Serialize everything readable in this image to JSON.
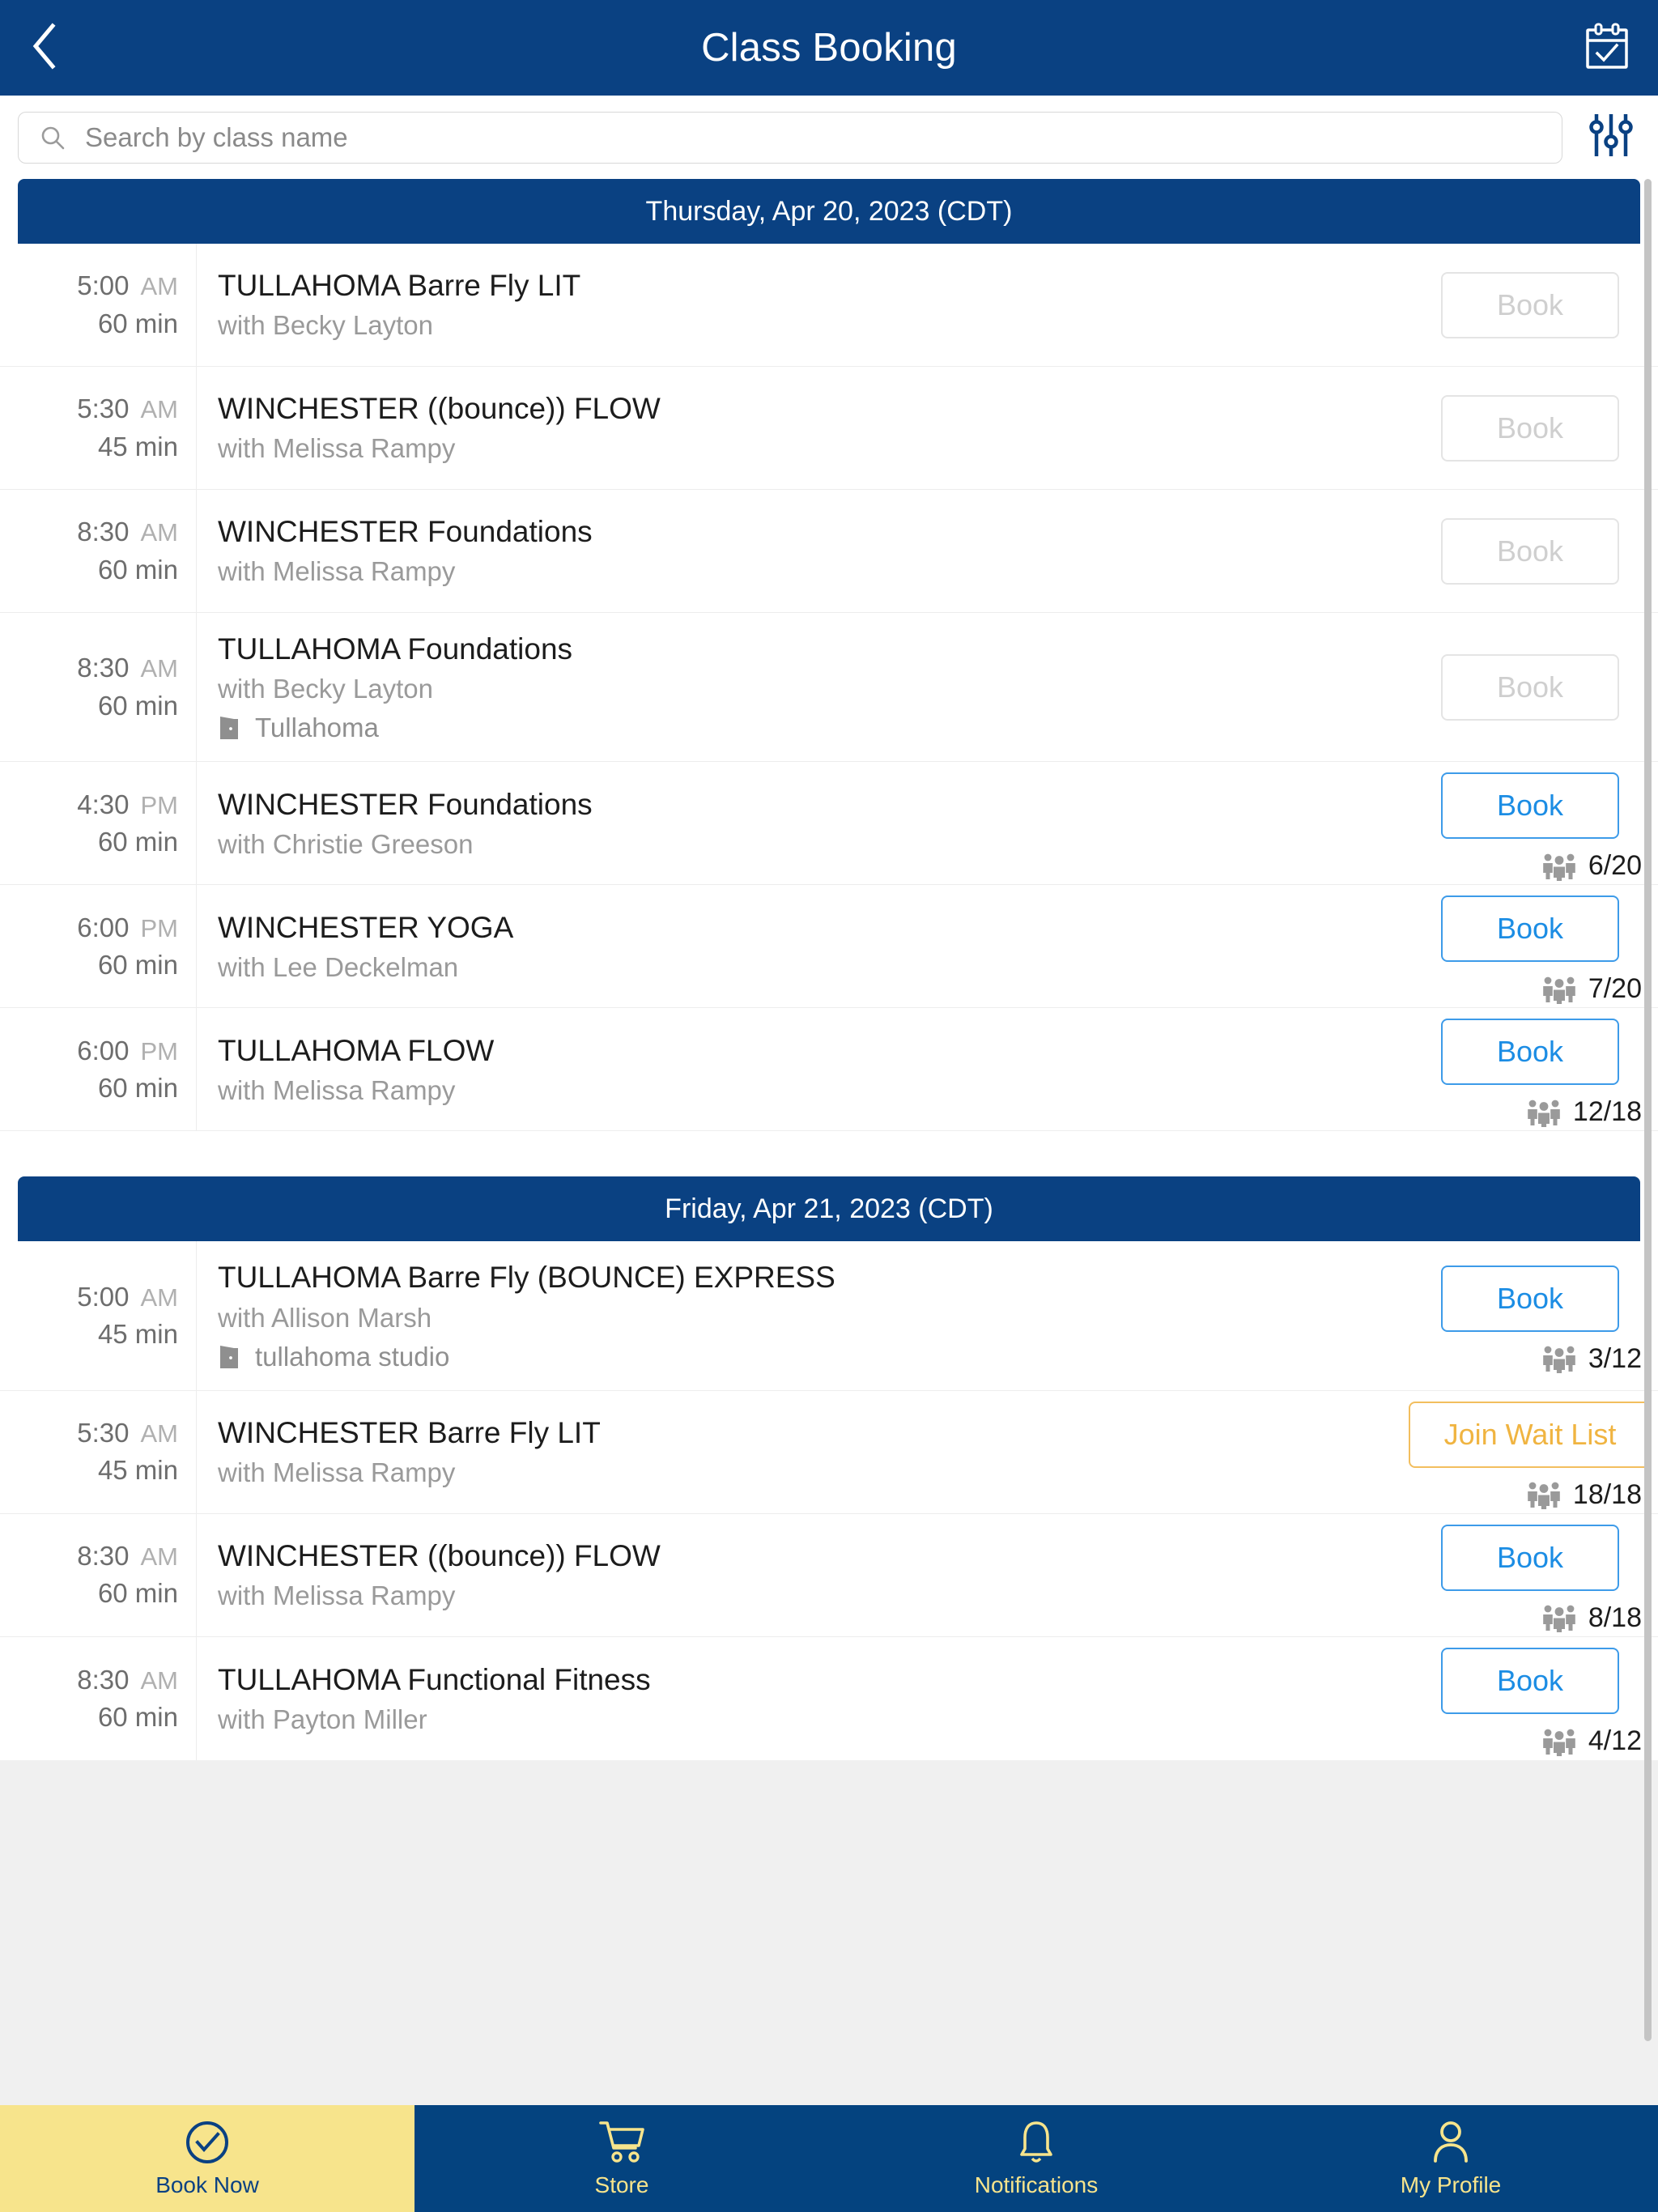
{
  "appbar": {
    "title": "Class Booking",
    "back_icon": "chevron-left-icon",
    "calendar_icon": "calendar-check-icon"
  },
  "search": {
    "placeholder": "Search by class name",
    "value": "",
    "icon": "search-icon",
    "filter_icon": "sliders-filter-icon"
  },
  "colors": {
    "navy": "#0A4182",
    "nav_navy": "#04437F",
    "accent_yellow": "#F7E48C",
    "book_blue": "#1C8DE4",
    "waitlist_amber": "#F0B441",
    "disabled_gray": "#cfcfcf",
    "page_gray": "#F0F0F0"
  },
  "days": [
    {
      "header": "Thursday, Apr 20, 2023 (CDT)",
      "classes": [
        {
          "time": "5:00",
          "ampm": "AM",
          "duration": "60 min",
          "title": "TULLAHOMA Barre Fly LIT",
          "instructor": "with Becky Layton",
          "location": "",
          "action_label": "Book",
          "action_state": "disabled",
          "capacity": ""
        },
        {
          "time": "5:30",
          "ampm": "AM",
          "duration": "45 min",
          "title": "WINCHESTER ((bounce)) FLOW",
          "instructor": "with Melissa Rampy",
          "location": "",
          "action_label": "Book",
          "action_state": "disabled",
          "capacity": ""
        },
        {
          "time": "8:30",
          "ampm": "AM",
          "duration": "60 min",
          "title": "WINCHESTER Foundations",
          "instructor": "with Melissa Rampy",
          "location": "",
          "action_label": "Book",
          "action_state": "disabled",
          "capacity": ""
        },
        {
          "time": "8:30",
          "ampm": "AM",
          "duration": "60 min",
          "title": "TULLAHOMA Foundations",
          "instructor": "with Becky Layton",
          "location": "Tullahoma",
          "action_label": "Book",
          "action_state": "disabled",
          "capacity": ""
        },
        {
          "time": "4:30",
          "ampm": "PM",
          "duration": "60 min",
          "title": "WINCHESTER Foundations",
          "instructor": "with Christie Greeson",
          "location": "",
          "action_label": "Book",
          "action_state": "enabled",
          "capacity": "6/20"
        },
        {
          "time": "6:00",
          "ampm": "PM",
          "duration": "60 min",
          "title": "WINCHESTER YOGA",
          "instructor": "with Lee Deckelman",
          "location": "",
          "action_label": "Book",
          "action_state": "enabled",
          "capacity": "7/20"
        },
        {
          "time": "6:00",
          "ampm": "PM",
          "duration": "60 min",
          "title": "TULLAHOMA FLOW",
          "instructor": "with Melissa Rampy",
          "location": "",
          "action_label": "Book",
          "action_state": "enabled",
          "capacity": "12/18"
        }
      ]
    },
    {
      "header": "Friday, Apr 21, 2023 (CDT)",
      "classes": [
        {
          "time": "5:00",
          "ampm": "AM",
          "duration": "45 min",
          "title": "TULLAHOMA Barre Fly (BOUNCE) EXPRESS",
          "instructor": "with Allison Marsh",
          "location": "tullahoma studio",
          "action_label": "Book",
          "action_state": "enabled",
          "capacity": "3/12"
        },
        {
          "time": "5:30",
          "ampm": "AM",
          "duration": "45 min",
          "title": "WINCHESTER Barre Fly LIT",
          "instructor": "with Melissa Rampy",
          "location": "",
          "action_label": "Join Wait List",
          "action_state": "waitlist",
          "capacity": "18/18"
        },
        {
          "time": "8:30",
          "ampm": "AM",
          "duration": "60 min",
          "title": "WINCHESTER ((bounce)) FLOW",
          "instructor": "with Melissa Rampy",
          "location": "",
          "action_label": "Book",
          "action_state": "enabled",
          "capacity": "8/18"
        },
        {
          "time": "8:30",
          "ampm": "AM",
          "duration": "60 min",
          "title": "TULLAHOMA Functional Fitness",
          "instructor": "with Payton Miller",
          "location": "",
          "action_label": "Book",
          "action_state": "enabled",
          "capacity": "4/12"
        }
      ]
    }
  ],
  "bottomnav": [
    {
      "label": "Book Now",
      "icon": "check-circle-icon",
      "active": true
    },
    {
      "label": "Store",
      "icon": "shopping-cart-icon",
      "active": false
    },
    {
      "label": "Notifications",
      "icon": "bell-icon",
      "active": false
    },
    {
      "label": "My Profile",
      "icon": "user-icon",
      "active": false
    }
  ]
}
